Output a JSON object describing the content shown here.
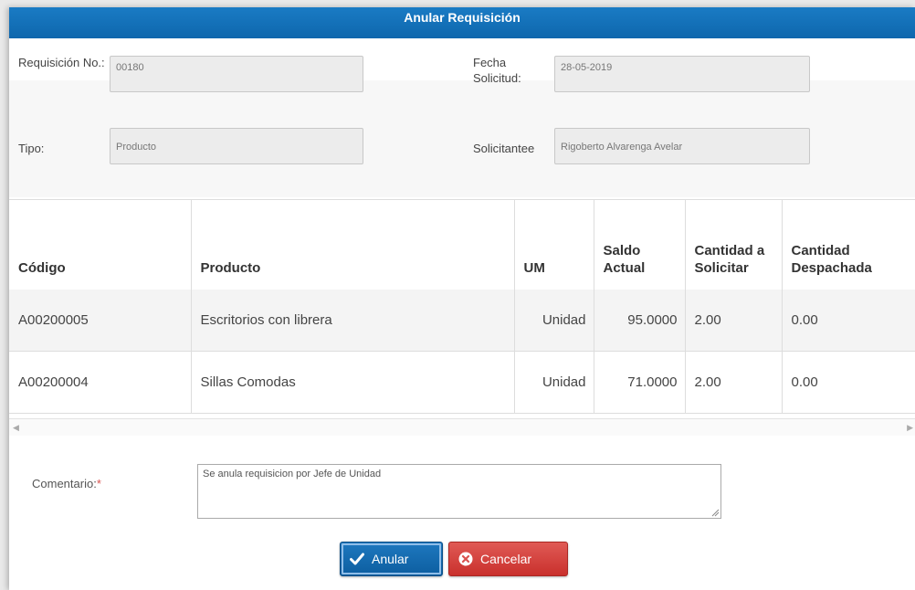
{
  "dialog": {
    "title": "Anular Requisición"
  },
  "form": {
    "requisicion_label": "Requisición No.:",
    "requisicion_value": "00180",
    "fecha_label": "Fecha Solicitud:",
    "fecha_value": "28-05-2019",
    "tipo_label": "Tipo:",
    "tipo_value": "Producto",
    "solicitante_label": "Solicitantee",
    "solicitante_value": "Rigoberto Alvarenga Avelar"
  },
  "table": {
    "headers": [
      "Código",
      "Producto",
      "UM",
      "Saldo Actual",
      "Cantidad a Solicitar",
      "Cantidad Despachada"
    ],
    "rows": [
      [
        "A00200005",
        "Escritorios con librera",
        "Unidad",
        "95.0000",
        "2.00",
        "0.00"
      ],
      [
        "A00200004",
        "Sillas Comodas",
        "Unidad",
        "71.0000",
        "2.00",
        "0.00"
      ]
    ]
  },
  "comment": {
    "label": "Comentario:",
    "required_mark": "*",
    "value": "Se anula requisicion por Jefe de Unidad"
  },
  "buttons": {
    "anular": "Anular",
    "cancelar": "Cancelar"
  },
  "colors": {
    "titlebar": "#0e67ad",
    "primary_button": "#1e78bf",
    "danger_button": "#d9534f"
  }
}
